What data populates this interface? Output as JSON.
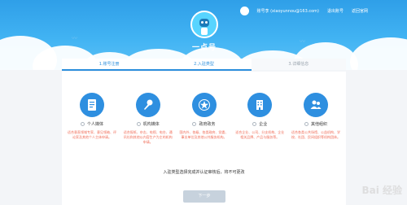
{
  "header": {
    "user_name": "账号李 (xiaoyunnou@163.com)",
    "link_logout": "退出账号",
    "link_official": "返回官网",
    "logo_text": "一点号"
  },
  "steps": [
    {
      "label": "1.账号注册",
      "state": "done"
    },
    {
      "label": "2.入驻类型",
      "state": "current"
    },
    {
      "label": "3.详细信息",
      "state": "todo"
    }
  ],
  "types": [
    {
      "label": "个人媒体",
      "desc": "适合垂直领域专家、意见领袖、评论家及其他个人主体申请。",
      "icon": "document-icon"
    },
    {
      "label": "机构媒体",
      "desc": "适合报纸、杂志、电视、电台、通讯社和其他以内容生产为主的机构申请。",
      "icon": "microphone-icon"
    },
    {
      "label": "政府政务",
      "desc": "国内外、各级、各类政府、党委、事业单位及其他公共服务机构。",
      "icon": "star-badge-icon"
    },
    {
      "label": "企业",
      "desc": "适合企业、公司、分支机构、企业相关品牌、产品与服务等。",
      "icon": "building-icon"
    },
    {
      "label": "其他组织",
      "desc": "适合各类公共场馆、公益机构、学校、社团、民间组织等机构团体。",
      "icon": "people-icon"
    }
  ],
  "notice": "入驻类型选择完成并认证审核后，将不可更改",
  "next_button": "下一步",
  "watermark": "Bai 经验",
  "colors": {
    "header": "#41b3f3",
    "accent": "#2c8fdc",
    "desc": "#f06a55"
  }
}
